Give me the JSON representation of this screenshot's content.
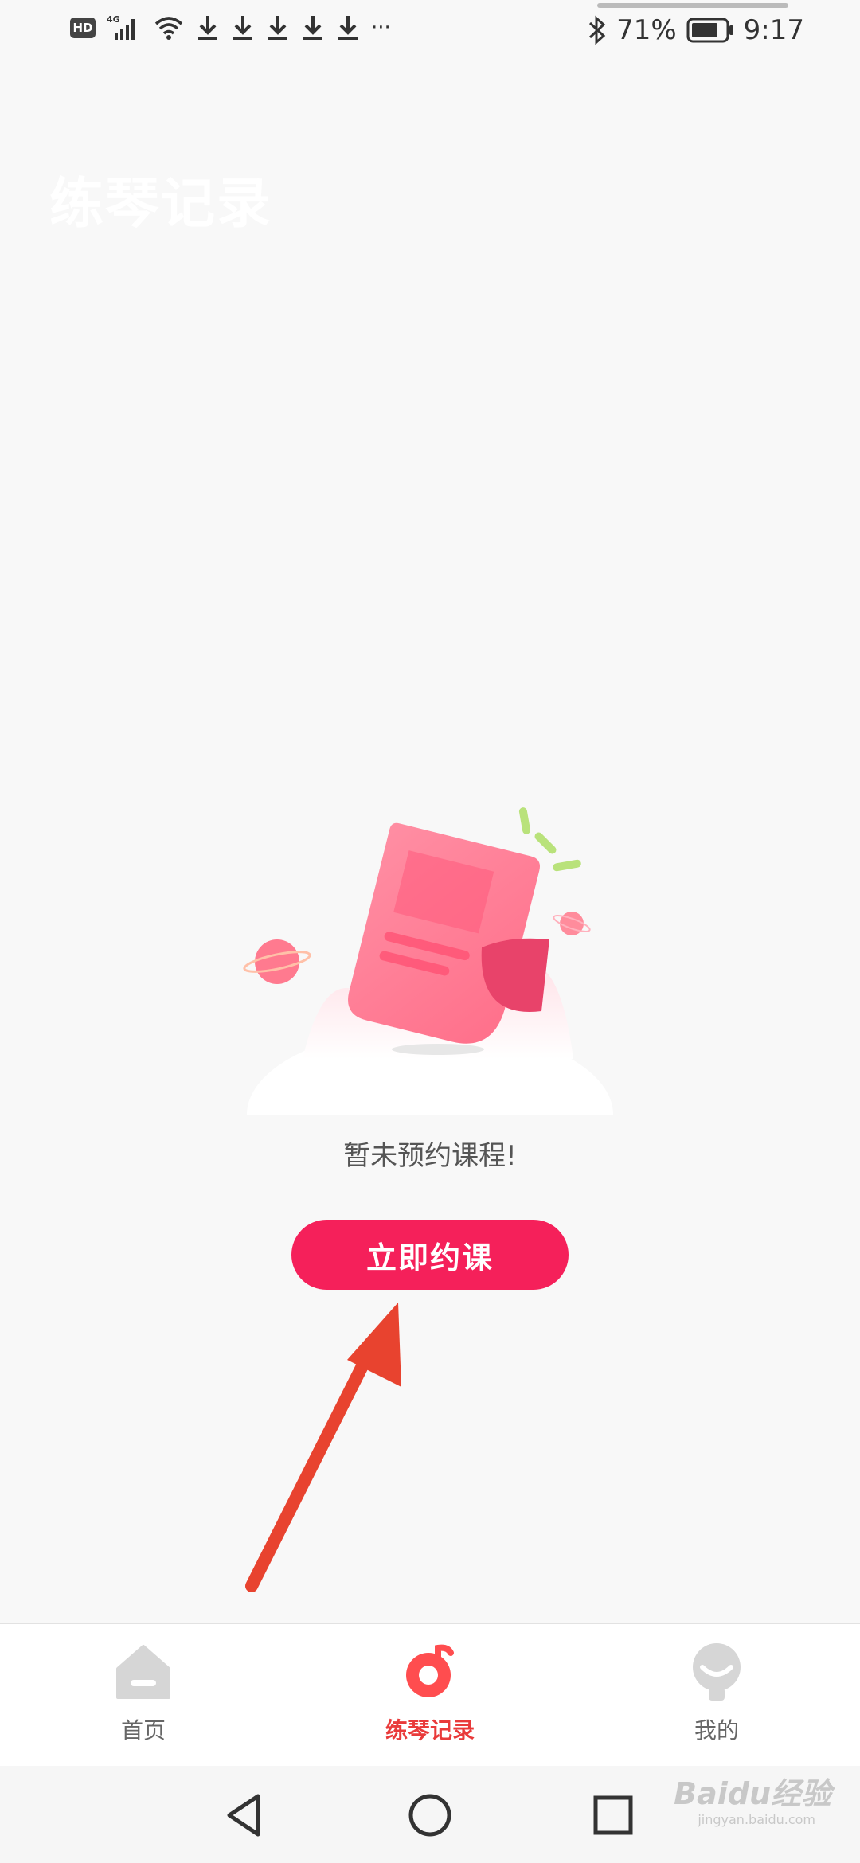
{
  "status_bar": {
    "network_badge": "HD",
    "network_type": "4G",
    "more_indicator": "···",
    "battery_percent": "71%",
    "time": "9:17",
    "icons": [
      "hd-badge",
      "signal-icon",
      "wifi-icon",
      "download-icon",
      "download-icon",
      "download-icon",
      "download-icon",
      "download-icon",
      "bluetooth-icon",
      "battery-icon"
    ]
  },
  "page": {
    "title": "练琴记录"
  },
  "empty_state": {
    "message": "暂未预约课程!",
    "button_label": "立即约课"
  },
  "tab_bar": {
    "tabs": [
      {
        "label": "首页",
        "icon": "home-icon",
        "active": false
      },
      {
        "label": "练琴记录",
        "icon": "music-note-icon",
        "active": true
      },
      {
        "label": "我的",
        "icon": "profile-icon",
        "active": false
      }
    ]
  },
  "nav_bar": {
    "buttons": [
      "back-icon",
      "home-circle-icon",
      "recent-apps-icon"
    ]
  },
  "watermark": {
    "text": "Baidu经验",
    "subtext": "jingyan.baidu.com"
  },
  "colors": {
    "accent": "#f5205a",
    "tab_active": "#e93a3a",
    "background": "#f8f8f8"
  }
}
